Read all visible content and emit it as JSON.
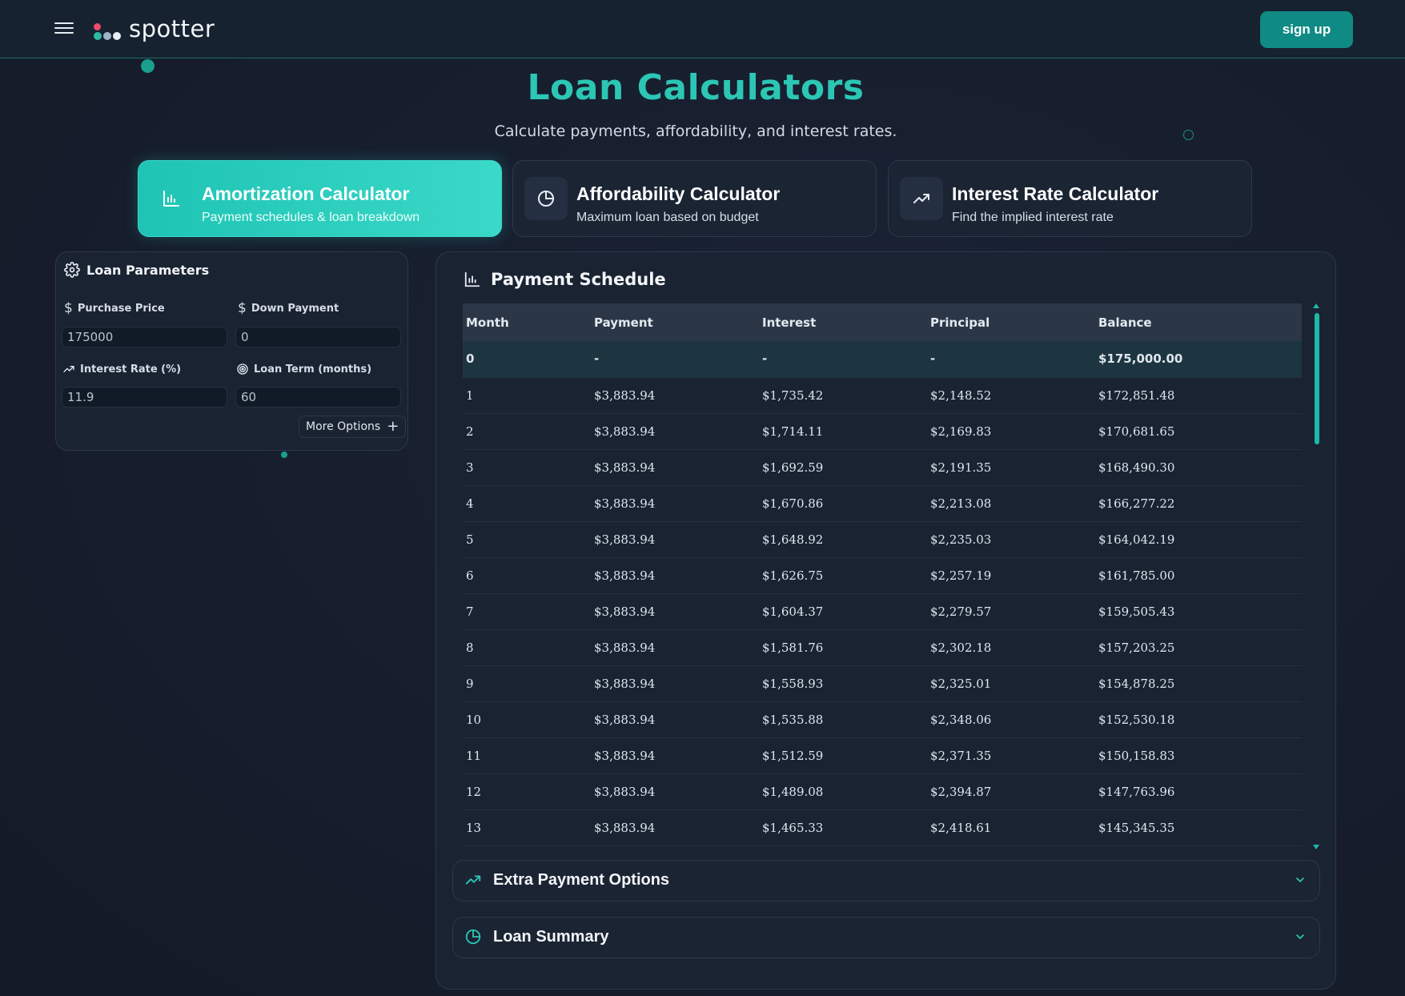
{
  "header": {
    "brand": "spotter",
    "signup_label": "sign up"
  },
  "page": {
    "title": "Loan Calculators",
    "subtitle": "Calculate payments, affordability, and interest rates."
  },
  "calculators": [
    {
      "title": "Amortization Calculator",
      "desc": "Payment schedules & loan breakdown",
      "icon": "bar-chart-icon",
      "active": true
    },
    {
      "title": "Affordability Calculator",
      "desc": "Maximum loan based on budget",
      "icon": "pie-chart-icon",
      "active": false
    },
    {
      "title": "Interest Rate Calculator",
      "desc": "Find the implied interest rate",
      "icon": "trending-up-icon",
      "active": false
    }
  ],
  "params": {
    "title": "Loan Parameters",
    "purchase_price_label": "Purchase Price",
    "purchase_price_value": "175000",
    "down_payment_label": "Down Payment",
    "down_payment_value": "0",
    "interest_rate_label": "Interest Rate (%)",
    "interest_rate_value": "11.9",
    "loan_term_label": "Loan Term (months)",
    "loan_term_value": "60",
    "more_options_label": "More Options"
  },
  "schedule": {
    "title": "Payment Schedule",
    "columns": [
      "Month",
      "Payment",
      "Interest",
      "Principal",
      "Balance"
    ],
    "rows": [
      [
        "0",
        "-",
        "-",
        "-",
        "$175,000.00"
      ],
      [
        "1",
        "$3,883.94",
        "$1,735.42",
        "$2,148.52",
        "$172,851.48"
      ],
      [
        "2",
        "$3,883.94",
        "$1,714.11",
        "$2,169.83",
        "$170,681.65"
      ],
      [
        "3",
        "$3,883.94",
        "$1,692.59",
        "$2,191.35",
        "$168,490.30"
      ],
      [
        "4",
        "$3,883.94",
        "$1,670.86",
        "$2,213.08",
        "$166,277.22"
      ],
      [
        "5",
        "$3,883.94",
        "$1,648.92",
        "$2,235.03",
        "$164,042.19"
      ],
      [
        "6",
        "$3,883.94",
        "$1,626.75",
        "$2,257.19",
        "$161,785.00"
      ],
      [
        "7",
        "$3,883.94",
        "$1,604.37",
        "$2,279.57",
        "$159,505.43"
      ],
      [
        "8",
        "$3,883.94",
        "$1,581.76",
        "$2,302.18",
        "$157,203.25"
      ],
      [
        "9",
        "$3,883.94",
        "$1,558.93",
        "$2,325.01",
        "$154,878.25"
      ],
      [
        "10",
        "$3,883.94",
        "$1,535.88",
        "$2,348.06",
        "$152,530.18"
      ],
      [
        "11",
        "$3,883.94",
        "$1,512.59",
        "$2,371.35",
        "$150,158.83"
      ],
      [
        "12",
        "$3,883.94",
        "$1,489.08",
        "$2,394.87",
        "$147,763.96"
      ],
      [
        "13",
        "$3,883.94",
        "$1,465.33",
        "$2,418.61",
        "$145,345.35"
      ]
    ]
  },
  "accordions": {
    "extra_payment": "Extra Payment Options",
    "loan_summary": "Loan Summary"
  },
  "colors": {
    "accent": "#2cc6b4",
    "accent_button": "#0f8a84",
    "background": "#161d2c",
    "panel": "#1a2332"
  }
}
